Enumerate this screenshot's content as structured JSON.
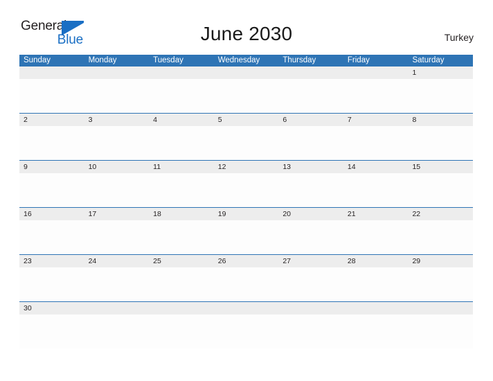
{
  "logo": {
    "word_one": "General",
    "word_two": "Blue",
    "flag_icon": "blue-triangle-flag-icon",
    "colors": {
      "text_dark": "#231f20",
      "blue": "#1a6fc4"
    }
  },
  "header": {
    "title": "June 2030",
    "country": "Turkey"
  },
  "calendar": {
    "month": "June",
    "year": "2030",
    "accent_color": "#2e74b5",
    "daynum_strip_color": "#ededed",
    "cell_body_color": "#fdfdfd",
    "weekdays": [
      "Sunday",
      "Monday",
      "Tuesday",
      "Wednesday",
      "Thursday",
      "Friday",
      "Saturday"
    ],
    "weeks": [
      [
        "",
        "",
        "",
        "",
        "",
        "",
        "1"
      ],
      [
        "2",
        "3",
        "4",
        "5",
        "6",
        "7",
        "8"
      ],
      [
        "9",
        "10",
        "11",
        "12",
        "13",
        "14",
        "15"
      ],
      [
        "16",
        "17",
        "18",
        "19",
        "20",
        "21",
        "22"
      ],
      [
        "23",
        "24",
        "25",
        "26",
        "27",
        "28",
        "29"
      ],
      [
        "30",
        "",
        "",
        "",
        "",
        "",
        ""
      ]
    ]
  }
}
